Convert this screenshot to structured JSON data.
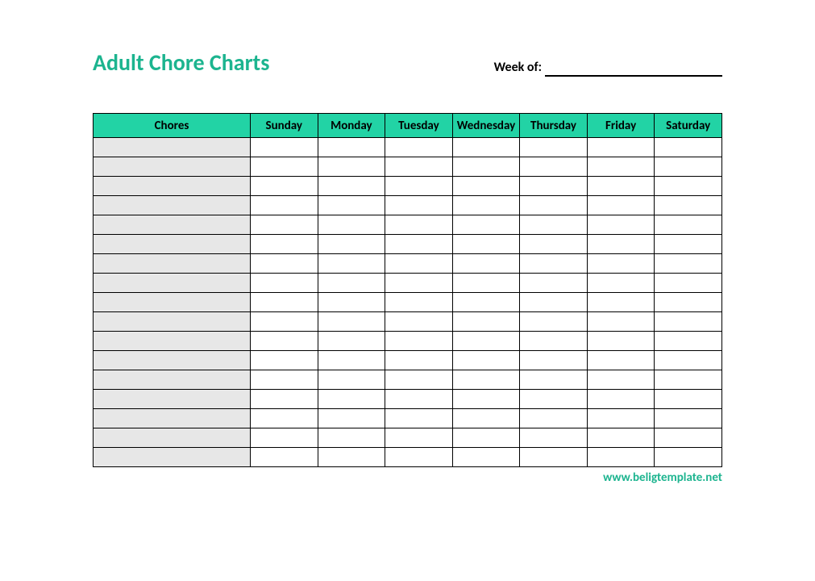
{
  "title": "Adult Chore Charts",
  "week_label": "Week of:",
  "columns": {
    "c0": "Chores",
    "c1": "Sunday",
    "c2": "Monday",
    "c3": "Tuesday",
    "c4": "Wednesday",
    "c5": "Thursday",
    "c6": "Friday",
    "c7": "Saturday"
  },
  "row_count": 17,
  "footer": "www.beligtemplate.net",
  "chart_data": {
    "type": "table",
    "title": "Adult Chore Charts",
    "columns": [
      "Chores",
      "Sunday",
      "Monday",
      "Tuesday",
      "Wednesday",
      "Thursday",
      "Friday",
      "Saturday"
    ],
    "rows": [
      [
        "",
        "",
        "",
        "",
        "",
        "",
        "",
        ""
      ],
      [
        "",
        "",
        "",
        "",
        "",
        "",
        "",
        ""
      ],
      [
        "",
        "",
        "",
        "",
        "",
        "",
        "",
        ""
      ],
      [
        "",
        "",
        "",
        "",
        "",
        "",
        "",
        ""
      ],
      [
        "",
        "",
        "",
        "",
        "",
        "",
        "",
        ""
      ],
      [
        "",
        "",
        "",
        "",
        "",
        "",
        "",
        ""
      ],
      [
        "",
        "",
        "",
        "",
        "",
        "",
        "",
        ""
      ],
      [
        "",
        "",
        "",
        "",
        "",
        "",
        "",
        ""
      ],
      [
        "",
        "",
        "",
        "",
        "",
        "",
        "",
        ""
      ],
      [
        "",
        "",
        "",
        "",
        "",
        "",
        "",
        ""
      ],
      [
        "",
        "",
        "",
        "",
        "",
        "",
        "",
        ""
      ],
      [
        "",
        "",
        "",
        "",
        "",
        "",
        "",
        ""
      ],
      [
        "",
        "",
        "",
        "",
        "",
        "",
        "",
        ""
      ],
      [
        "",
        "",
        "",
        "",
        "",
        "",
        "",
        ""
      ],
      [
        "",
        "",
        "",
        "",
        "",
        "",
        "",
        ""
      ],
      [
        "",
        "",
        "",
        "",
        "",
        "",
        "",
        ""
      ],
      [
        "",
        "",
        "",
        "",
        "",
        "",
        "",
        ""
      ]
    ]
  }
}
